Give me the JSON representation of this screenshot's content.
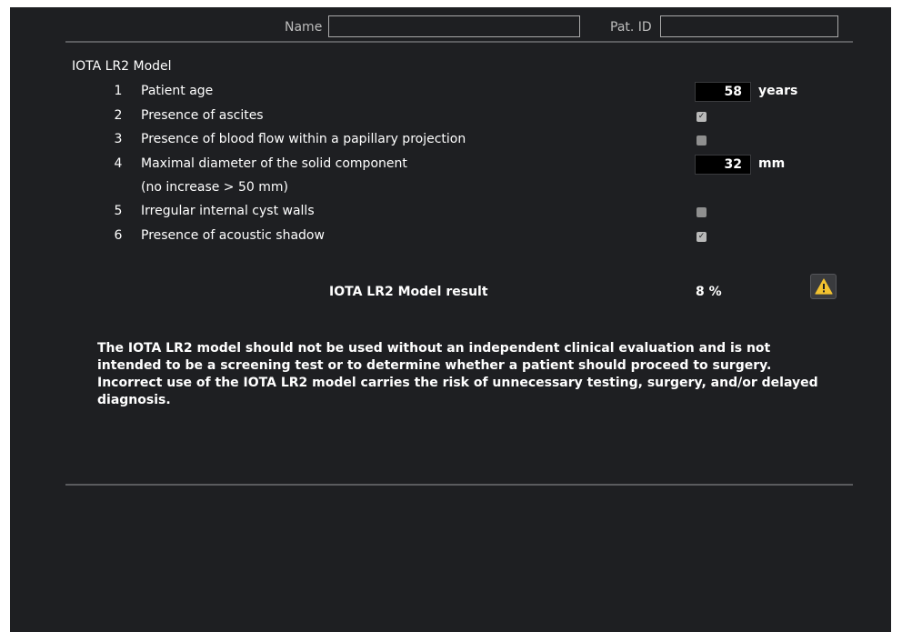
{
  "header": {
    "name_label": "Name",
    "name_value": "",
    "patid_label": "Pat. ID",
    "patid_value": ""
  },
  "model": {
    "title": "IOTA LR2 Model",
    "items": [
      {
        "num": "1",
        "label": "Patient age",
        "type": "number",
        "value": "58",
        "unit": "years"
      },
      {
        "num": "2",
        "label": "Presence of ascites",
        "type": "checkbox",
        "checked": true
      },
      {
        "num": "3",
        "label": "Presence of blood flow within a papillary projection",
        "type": "checkbox",
        "checked": false
      },
      {
        "num": "4",
        "label": "Maximal diameter of the solid component",
        "type": "number",
        "value": "32",
        "unit": "mm",
        "sublabel": "(no increase > 50 mm)"
      },
      {
        "num": "5",
        "label": "Irregular internal cyst walls",
        "type": "checkbox",
        "checked": false
      },
      {
        "num": "6",
        "label": "Presence of acoustic shadow",
        "type": "checkbox",
        "checked": true
      }
    ],
    "result_label": "IOTA LR2 Model result",
    "result_value": "8 %",
    "warning_icon": "warning-triangle-icon"
  },
  "disclaimer": "The IOTA LR2 model should not be used without an independent clinical evaluation and is not intended to be a screening test or to determine whether a patient should proceed to surgery. Incorrect use of the IOTA LR2 model carries the risk of unnecessary testing, surgery, and/or delayed diagnosis.",
  "colors": {
    "panel_background": "#1e1f22",
    "text": "#ffffff",
    "warning_icon": "#f2c230"
  }
}
